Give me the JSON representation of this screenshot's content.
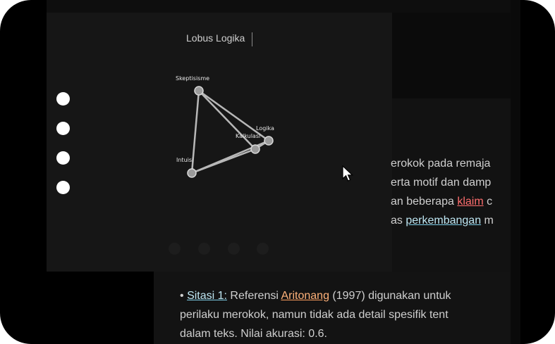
{
  "panel": {
    "title": "Lobus Logika",
    "nodes": [
      {
        "id": "skeptisisme",
        "label": "Skeptisisme"
      },
      {
        "id": "logika",
        "label": "Logika"
      },
      {
        "id": "kalkulasi",
        "label": "Kalkulasi"
      },
      {
        "id": "intuisi",
        "label": "Intuisi"
      }
    ]
  },
  "document": {
    "lines": [
      "erokok pada remaja",
      "erta motif dan damp",
      "an beberapa ",
      "klaim",
      " c",
      "as ",
      "perkembangan",
      " m"
    ],
    "citation": {
      "bullet": "•",
      "label": "Sitasi 1:",
      "text_before": " Referensi ",
      "author": "Aritonang",
      "text_after": " (1997) digunakan untuk",
      "line2": "perilaku merokok, namun tidak ada detail spesifik tent",
      "line3": "dalam teks. Nilai akurasi: 0.6."
    }
  },
  "colors": {
    "background": "#000000",
    "panel": "#161616",
    "text": "#cfcfcf",
    "claim": "#ff6e6e",
    "link": "#bfe7f3",
    "author": "#ffb27a"
  }
}
